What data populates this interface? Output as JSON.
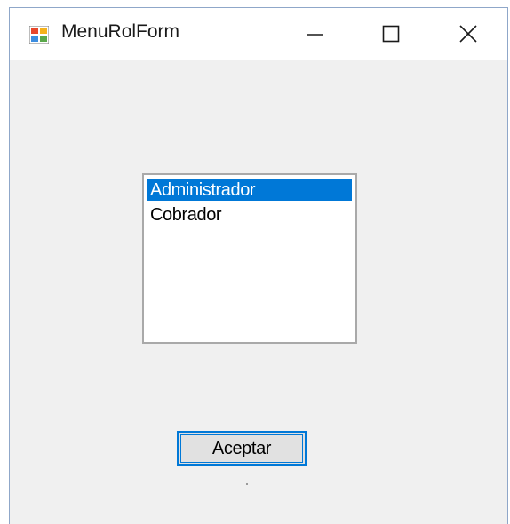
{
  "window": {
    "title": "MenuRolForm",
    "icons": {
      "app": "form-app-icon",
      "minimize": "minimize-icon",
      "maximize": "maximize-icon",
      "close": "close-icon"
    }
  },
  "roles_list": {
    "items": [
      {
        "label": "Administrador",
        "selected": true
      },
      {
        "label": "Cobrador",
        "selected": false
      }
    ]
  },
  "accept_button": {
    "label": "Aceptar"
  },
  "colors": {
    "selection": "#0078d7",
    "client_area": "#f0f0f0",
    "window_border": "#8fa7c9"
  }
}
